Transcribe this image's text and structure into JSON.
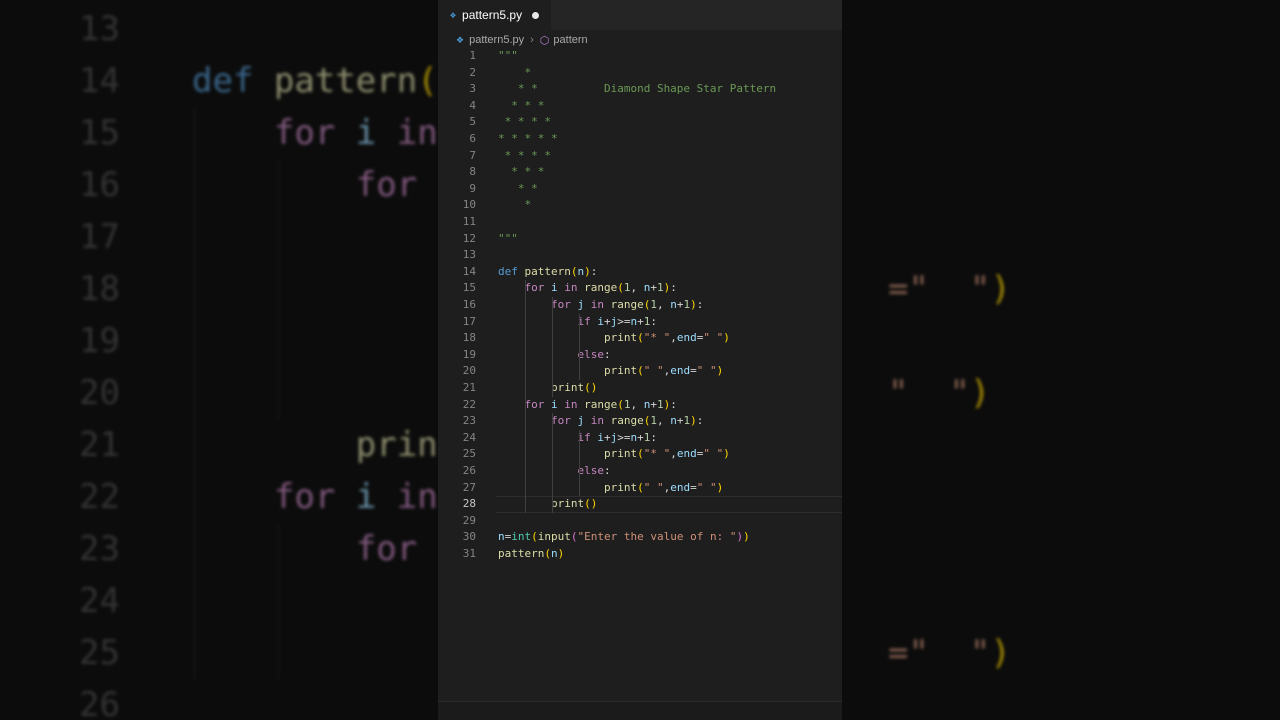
{
  "editor": {
    "tab": {
      "filename": "pattern5.py",
      "icon": "python-file-icon",
      "unsaved": true
    },
    "breadcrumbs": {
      "file": "pattern5.py",
      "symbol": "pattern"
    },
    "active_line": 28,
    "lines": [
      {
        "n": "1",
        "t": [
          [
            "doc",
            "\"\"\""
          ]
        ]
      },
      {
        "n": "2",
        "t": [
          [
            "doc",
            "    *"
          ]
        ]
      },
      {
        "n": "3",
        "t": [
          [
            "doc",
            "   * *          Diamond Shape Star Pattern"
          ]
        ]
      },
      {
        "n": "4",
        "t": [
          [
            "doc",
            "  * * *"
          ]
        ]
      },
      {
        "n": "5",
        "t": [
          [
            "doc",
            " * * * *"
          ]
        ]
      },
      {
        "n": "6",
        "t": [
          [
            "doc",
            "* * * * *"
          ]
        ]
      },
      {
        "n": "7",
        "t": [
          [
            "doc",
            " * * * *"
          ]
        ]
      },
      {
        "n": "8",
        "t": [
          [
            "doc",
            "  * * *"
          ]
        ]
      },
      {
        "n": "9",
        "t": [
          [
            "doc",
            "   * *"
          ]
        ]
      },
      {
        "n": "10",
        "t": [
          [
            "doc",
            "    *"
          ]
        ]
      },
      {
        "n": "11",
        "t": []
      },
      {
        "n": "12",
        "t": [
          [
            "doc",
            "\"\"\""
          ]
        ]
      },
      {
        "n": "13",
        "t": []
      },
      {
        "n": "14",
        "t": [
          [
            "kw",
            "def "
          ],
          [
            "fn",
            "pattern"
          ],
          [
            "br1",
            "("
          ],
          [
            "var",
            "n"
          ],
          [
            "br1",
            ")"
          ],
          [
            "op",
            ":"
          ]
        ]
      },
      {
        "n": "15",
        "t": [
          [
            "op",
            "    "
          ],
          [
            "ctl",
            "for "
          ],
          [
            "var",
            "i "
          ],
          [
            "ctl",
            "in "
          ],
          [
            "fn",
            "range"
          ],
          [
            "br1",
            "("
          ],
          [
            "num",
            "1"
          ],
          [
            "op",
            ", "
          ],
          [
            "var",
            "n"
          ],
          [
            "op",
            "+"
          ],
          [
            "num",
            "1"
          ],
          [
            "br1",
            ")"
          ],
          [
            "op",
            ":"
          ]
        ]
      },
      {
        "n": "16",
        "t": [
          [
            "op",
            "        "
          ],
          [
            "ctl",
            "for "
          ],
          [
            "var",
            "j "
          ],
          [
            "ctl",
            "in "
          ],
          [
            "fn",
            "range"
          ],
          [
            "br1",
            "("
          ],
          [
            "num",
            "1"
          ],
          [
            "op",
            ", "
          ],
          [
            "var",
            "n"
          ],
          [
            "op",
            "+"
          ],
          [
            "num",
            "1"
          ],
          [
            "br1",
            ")"
          ],
          [
            "op",
            ":"
          ]
        ]
      },
      {
        "n": "17",
        "t": [
          [
            "op",
            "            "
          ],
          [
            "ctl",
            "if "
          ],
          [
            "var",
            "i"
          ],
          [
            "op",
            "+"
          ],
          [
            "var",
            "j"
          ],
          [
            "op",
            ">="
          ],
          [
            "var",
            "n"
          ],
          [
            "op",
            "+"
          ],
          [
            "num",
            "1"
          ],
          [
            "op",
            ":"
          ]
        ]
      },
      {
        "n": "18",
        "t": [
          [
            "op",
            "                "
          ],
          [
            "fn",
            "print"
          ],
          [
            "br1",
            "("
          ],
          [
            "str",
            "\"* \""
          ],
          [
            "op",
            ","
          ],
          [
            "var",
            "end"
          ],
          [
            "op",
            "="
          ],
          [
            "str",
            "\" \""
          ],
          [
            "br1",
            ")"
          ]
        ]
      },
      {
        "n": "19",
        "t": [
          [
            "op",
            "            "
          ],
          [
            "ctl",
            "else"
          ],
          [
            "op",
            ":"
          ]
        ]
      },
      {
        "n": "20",
        "t": [
          [
            "op",
            "                "
          ],
          [
            "fn",
            "print"
          ],
          [
            "br1",
            "("
          ],
          [
            "str",
            "\" \""
          ],
          [
            "op",
            ","
          ],
          [
            "var",
            "end"
          ],
          [
            "op",
            "="
          ],
          [
            "str",
            "\" \""
          ],
          [
            "br1",
            ")"
          ]
        ]
      },
      {
        "n": "21",
        "t": [
          [
            "op",
            "        "
          ],
          [
            "fn",
            "print"
          ],
          [
            "br1",
            "()"
          ]
        ]
      },
      {
        "n": "22",
        "t": [
          [
            "op",
            "    "
          ],
          [
            "ctl",
            "for "
          ],
          [
            "var",
            "i "
          ],
          [
            "ctl",
            "in "
          ],
          [
            "fn",
            "range"
          ],
          [
            "br1",
            "("
          ],
          [
            "num",
            "1"
          ],
          [
            "op",
            ", "
          ],
          [
            "var",
            "n"
          ],
          [
            "op",
            "+"
          ],
          [
            "num",
            "1"
          ],
          [
            "br1",
            ")"
          ],
          [
            "op",
            ":"
          ]
        ]
      },
      {
        "n": "23",
        "t": [
          [
            "op",
            "        "
          ],
          [
            "ctl",
            "for "
          ],
          [
            "var",
            "j "
          ],
          [
            "ctl",
            "in "
          ],
          [
            "fn",
            "range"
          ],
          [
            "br1",
            "("
          ],
          [
            "num",
            "1"
          ],
          [
            "op",
            ", "
          ],
          [
            "var",
            "n"
          ],
          [
            "op",
            "+"
          ],
          [
            "num",
            "1"
          ],
          [
            "br1",
            ")"
          ],
          [
            "op",
            ":"
          ]
        ]
      },
      {
        "n": "24",
        "t": [
          [
            "op",
            "            "
          ],
          [
            "ctl",
            "if "
          ],
          [
            "var",
            "i"
          ],
          [
            "op",
            "+"
          ],
          [
            "var",
            "j"
          ],
          [
            "op",
            ">="
          ],
          [
            "var",
            "n"
          ],
          [
            "op",
            "+"
          ],
          [
            "num",
            "1"
          ],
          [
            "op",
            ":"
          ]
        ]
      },
      {
        "n": "25",
        "t": [
          [
            "op",
            "                "
          ],
          [
            "fn",
            "print"
          ],
          [
            "br1",
            "("
          ],
          [
            "str",
            "\"* \""
          ],
          [
            "op",
            ","
          ],
          [
            "var",
            "end"
          ],
          [
            "op",
            "="
          ],
          [
            "str",
            "\" \""
          ],
          [
            "br1",
            ")"
          ]
        ]
      },
      {
        "n": "26",
        "t": [
          [
            "op",
            "            "
          ],
          [
            "ctl",
            "else"
          ],
          [
            "op",
            ":"
          ]
        ]
      },
      {
        "n": "27",
        "t": [
          [
            "op",
            "                "
          ],
          [
            "fn",
            "print"
          ],
          [
            "br1",
            "("
          ],
          [
            "str",
            "\" \""
          ],
          [
            "op",
            ","
          ],
          [
            "var",
            "end"
          ],
          [
            "op",
            "="
          ],
          [
            "str",
            "\" \""
          ],
          [
            "br1",
            ")"
          ]
        ]
      },
      {
        "n": "28",
        "t": [
          [
            "op",
            "        "
          ],
          [
            "fn",
            "print"
          ],
          [
            "br1",
            "()"
          ]
        ]
      },
      {
        "n": "29",
        "t": []
      },
      {
        "n": "30",
        "t": [
          [
            "var",
            "n"
          ],
          [
            "op",
            "="
          ],
          [
            "cls",
            "int"
          ],
          [
            "br1",
            "("
          ],
          [
            "fn",
            "input"
          ],
          [
            "br2",
            "("
          ],
          [
            "str",
            "\"Enter the value of n: \""
          ],
          [
            "br2",
            ")"
          ],
          [
            "br1",
            ")"
          ]
        ]
      },
      {
        "n": "31",
        "t": [
          [
            "fn",
            "pattern"
          ],
          [
            "br1",
            "("
          ],
          [
            "var",
            "n"
          ],
          [
            "br1",
            ")"
          ]
        ]
      }
    ]
  },
  "background": {
    "lines": [
      {
        "n": "13",
        "t": []
      },
      {
        "n": "14",
        "t": [
          [
            "kw",
            "def "
          ],
          [
            "fn",
            "pattern"
          ],
          [
            "br1",
            "("
          ]
        ]
      },
      {
        "n": "15",
        "t": [
          [
            "op",
            "    "
          ],
          [
            "ctl",
            "for "
          ],
          [
            "var",
            "i "
          ],
          [
            "ctl",
            "in"
          ]
        ]
      },
      {
        "n": "16",
        "t": [
          [
            "op",
            "        "
          ],
          [
            "ctl",
            "for"
          ]
        ]
      },
      {
        "n": "17",
        "t": []
      },
      {
        "n": "18",
        "t": [
          [
            "op",
            "                                  "
          ],
          [
            "str",
            "=\"  \""
          ],
          [
            "br1",
            ")"
          ]
        ]
      },
      {
        "n": "19",
        "t": []
      },
      {
        "n": "20",
        "t": [
          [
            "op",
            "                                  "
          ],
          [
            "str",
            "\"  \""
          ],
          [
            "br1",
            ")"
          ]
        ]
      },
      {
        "n": "21",
        "t": [
          [
            "op",
            "        "
          ],
          [
            "fn",
            "prin"
          ]
        ]
      },
      {
        "n": "22",
        "t": [
          [
            "op",
            "    "
          ],
          [
            "ctl",
            "for "
          ],
          [
            "var",
            "i "
          ],
          [
            "ctl",
            "in"
          ]
        ]
      },
      {
        "n": "23",
        "t": [
          [
            "op",
            "        "
          ],
          [
            "ctl",
            "for"
          ]
        ]
      },
      {
        "n": "24",
        "t": []
      },
      {
        "n": "25",
        "t": [
          [
            "op",
            "                                  "
          ],
          [
            "str",
            "=\"  \""
          ],
          [
            "br1",
            ")"
          ]
        ]
      },
      {
        "n": "26",
        "t": []
      }
    ]
  }
}
